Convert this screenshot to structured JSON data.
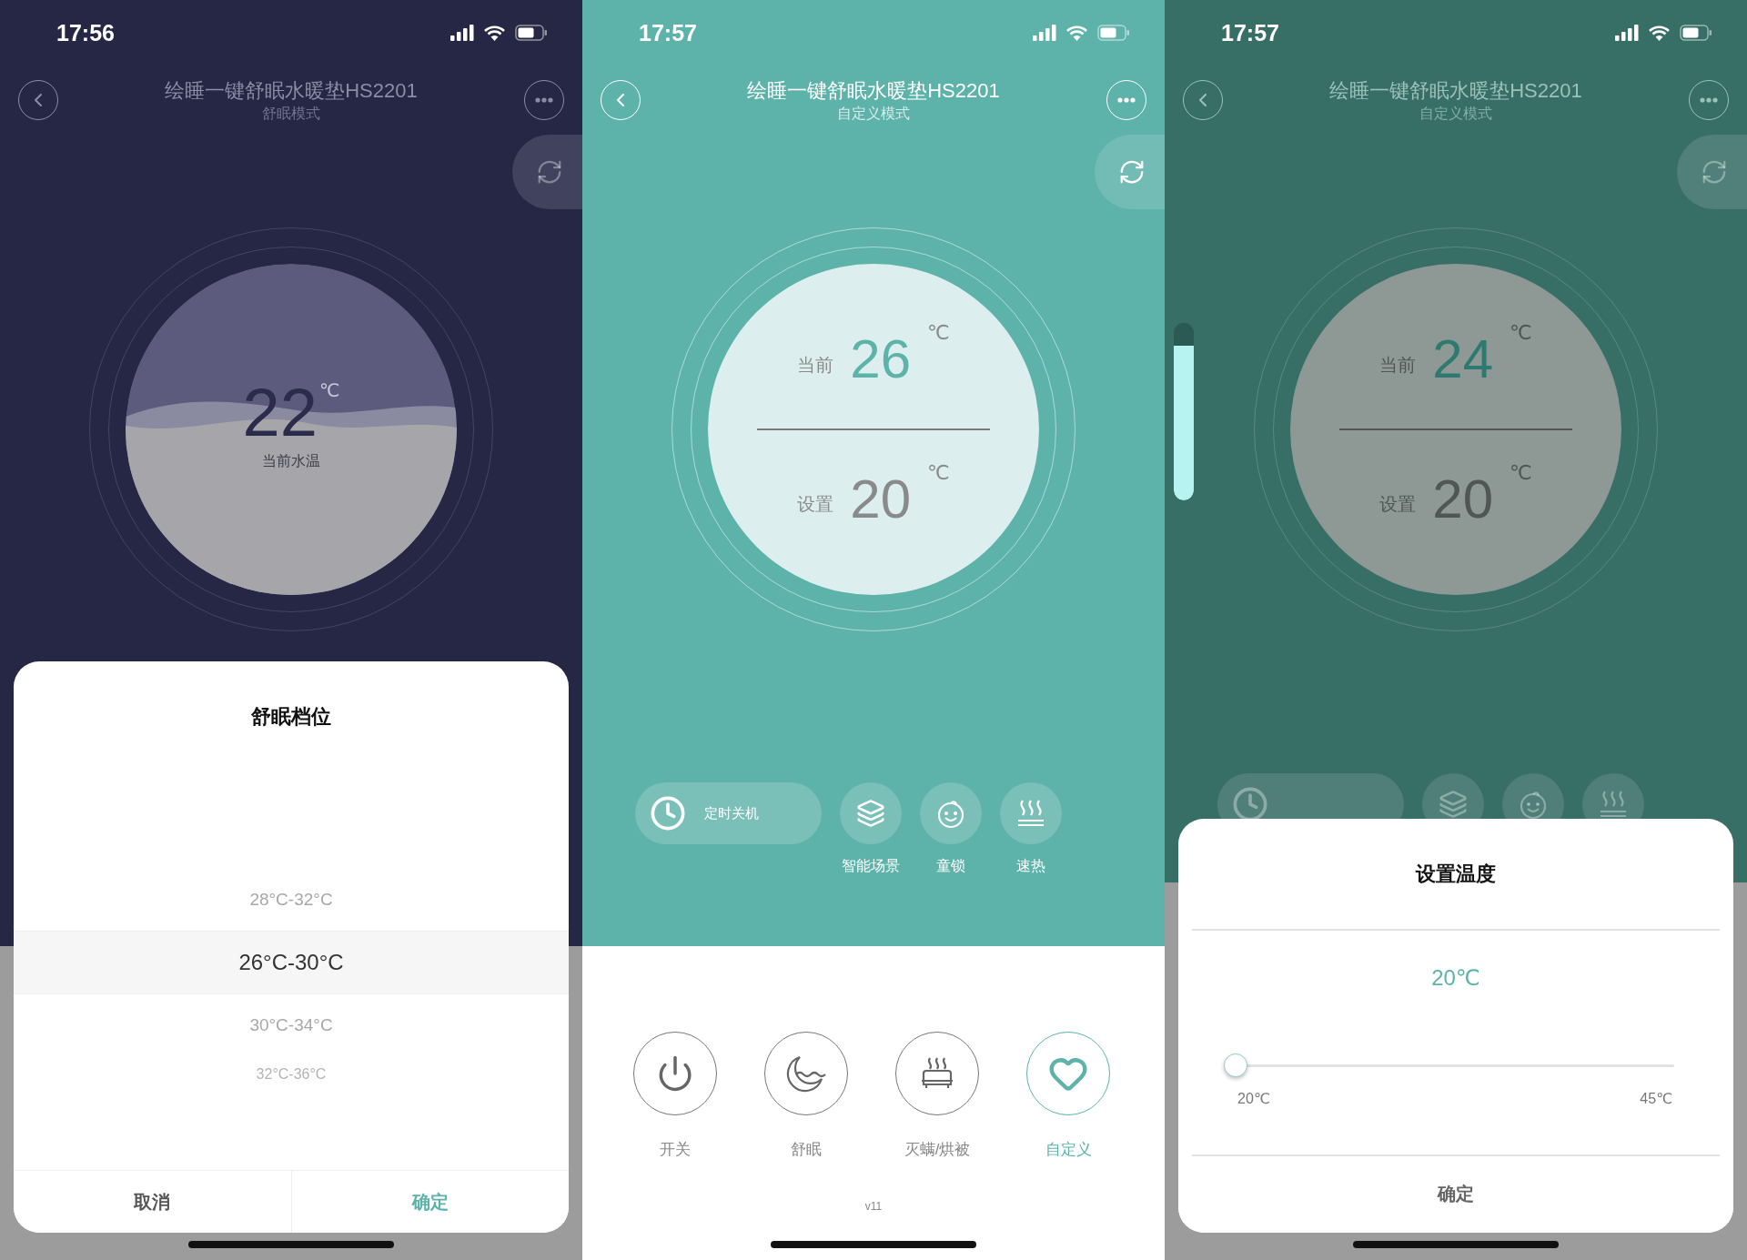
{
  "screens": [
    {
      "dimmed": true,
      "status_bar": {
        "time": "17:56"
      },
      "header": {
        "title": "绘睡一键舒眠水暖垫HS2201",
        "subtitle": "舒眠模式"
      },
      "dial": {
        "kind": "wave",
        "value": "22",
        "unit": "℃",
        "caption": "当前水温"
      },
      "sheet": {
        "kind": "picker",
        "title": "舒眠档位",
        "options": [
          {
            "label": "28°C-32°C",
            "selected": false
          },
          {
            "label": "26°C-30°C",
            "selected": true
          },
          {
            "label": "30°C-34°C",
            "selected": false
          },
          {
            "label": "32°C-36°C",
            "selected": false
          }
        ],
        "buttons": [
          {
            "label": "取消",
            "primary": false
          },
          {
            "label": "确定",
            "primary": true
          }
        ]
      }
    },
    {
      "dimmed": false,
      "status_bar": {
        "time": "17:57"
      },
      "header": {
        "title": "绘睡一键舒眠水暖垫HS2201",
        "subtitle": "自定义模式"
      },
      "dial": {
        "kind": "split",
        "current": {
          "label": "当前",
          "value": "26",
          "unit": "℃"
        },
        "set": {
          "label": "设置",
          "value": "20",
          "unit": "℃"
        }
      },
      "functions": [
        {
          "kind": "timer",
          "label": "定时关机"
        },
        {
          "kind": "scene",
          "label": "智能场景"
        },
        {
          "kind": "lock",
          "label": "童锁"
        },
        {
          "kind": "heat",
          "label": "速热"
        }
      ],
      "modes": [
        {
          "kind": "power",
          "label": "开关",
          "selected": false
        },
        {
          "kind": "sleep",
          "label": "舒眠",
          "selected": false
        },
        {
          "kind": "mite",
          "label": "灭螨/烘被",
          "selected": false
        },
        {
          "kind": "custom",
          "label": "自定义",
          "selected": true
        }
      ],
      "version": "v11"
    },
    {
      "dimmed": true,
      "status_bar": {
        "time": "17:57"
      },
      "header": {
        "title": "绘睡一键舒眠水暖垫HS2201",
        "subtitle": "自定义模式"
      },
      "side_bar": {
        "level": 0.87
      },
      "dial": {
        "kind": "split",
        "current": {
          "label": "当前",
          "value": "24",
          "unit": "℃"
        },
        "set": {
          "label": "设置",
          "value": "20",
          "unit": "℃"
        }
      },
      "functions": [
        {
          "kind": "timer"
        },
        {
          "kind": "scene"
        },
        {
          "kind": "lock"
        },
        {
          "kind": "heat"
        }
      ],
      "sheet": {
        "kind": "slider",
        "title": "设置温度",
        "value": "20℃",
        "level": 0,
        "min_label": "20℃",
        "max_label": "45℃",
        "button": "确定"
      }
    }
  ]
}
